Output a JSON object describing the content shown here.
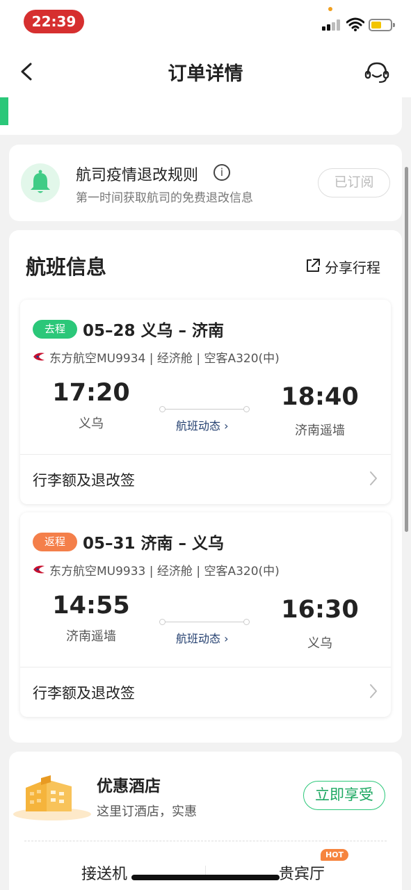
{
  "status_bar": {
    "time": "22:39"
  },
  "nav": {
    "title": "订单详情"
  },
  "notice": {
    "title": "航司疫情退改规则",
    "info": "i",
    "subtitle": "第一时间获取航司的免费退改信息",
    "button": "已订阅"
  },
  "flight_info": {
    "title": "航班信息",
    "share_label": "分享行程",
    "legs": [
      {
        "tag": "去程",
        "route": "05–28 义乌 – 济南",
        "airline": "东方航空MU9934 | 经济舱 | 空客A320(中)",
        "dep_time": "17:20",
        "dep_city": "义乌",
        "arr_time": "18:40",
        "arr_city": "济南遥墙",
        "dynamics": "航班动态 ›",
        "luggage": "行李额及退改签"
      },
      {
        "tag": "返程",
        "route": "05–31 济南 – 义乌",
        "airline": "东方航空MU9933 | 经济舱 | 空客A320(中)",
        "dep_time": "14:55",
        "dep_city": "济南遥墙",
        "arr_time": "16:30",
        "arr_city": "义乌",
        "dynamics": "航班动态 ›",
        "luggage": "行李额及退改签"
      }
    ]
  },
  "hotel": {
    "title": "优惠酒店",
    "subtitle": "这里订酒店，实惠",
    "button": "立即享受"
  },
  "services": {
    "pickup": "接送机",
    "vip_lounge": "贵宾厅",
    "hot_badge": "HOT"
  },
  "colors": {
    "accent_green": "#2bc779",
    "tag_orange": "#f47f4a",
    "link_navy": "#233f6f",
    "time_pill_red": "#d62f2f"
  }
}
